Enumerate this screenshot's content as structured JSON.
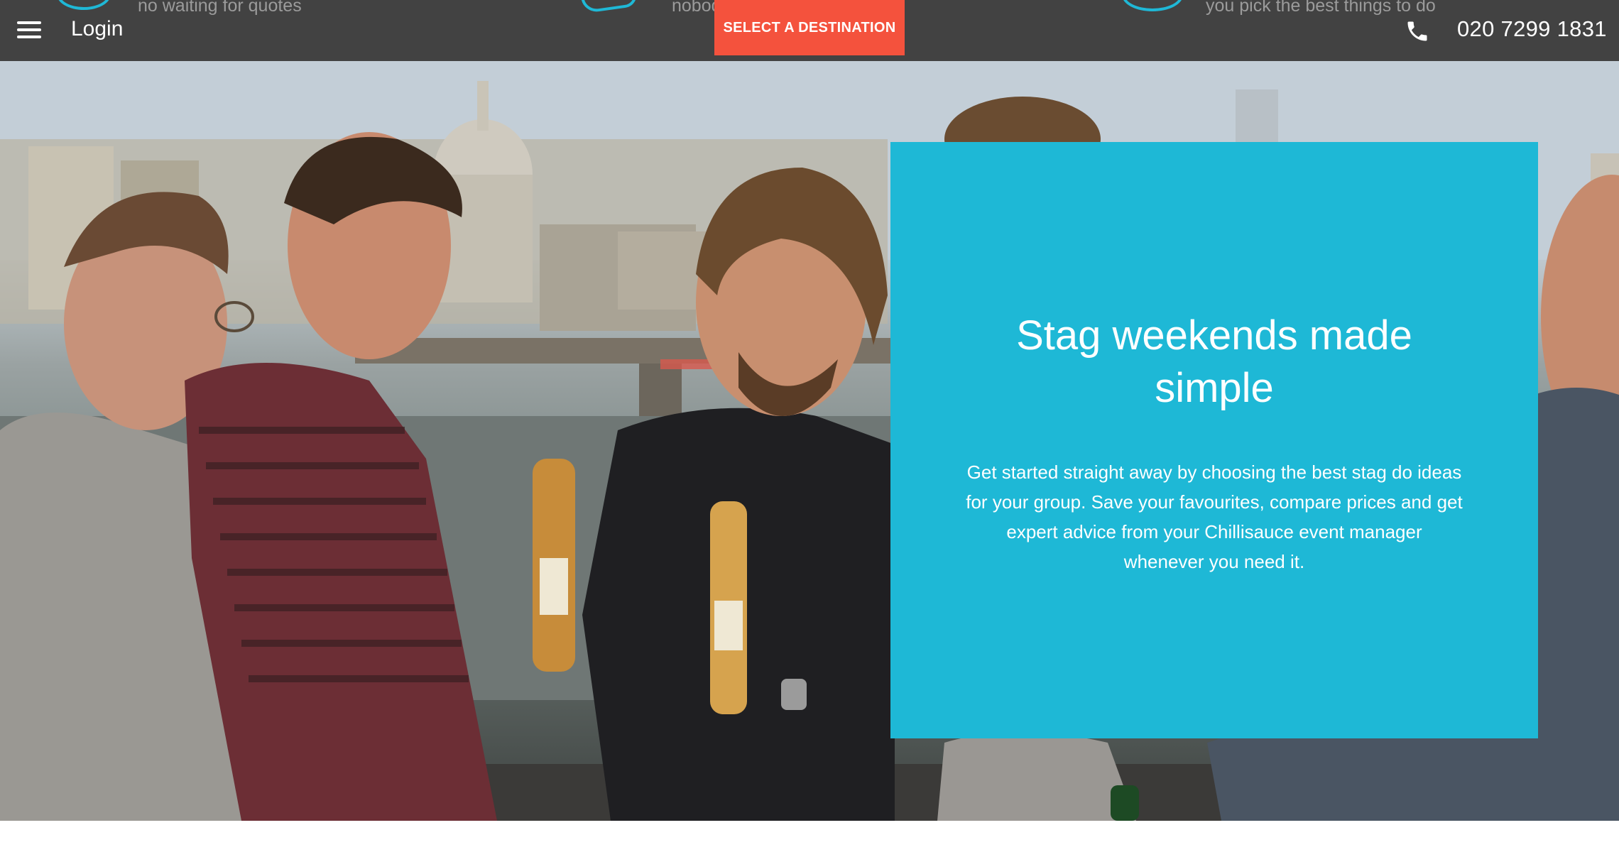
{
  "header": {
    "login_label": "Login",
    "cta_label": "SELECT A DESTINATION",
    "phone_number": "020 7299 1831",
    "peek_texts": [
      "no waiting for quotes",
      "nobody will be out of pocket",
      "you pick the best things to do"
    ]
  },
  "hero": {
    "title": "Stag weekends made simple",
    "body": "Get started straight away by choosing the best stag do ideas for your group. Save your favourites, compare prices and get expert advice from your Chillisauce event manager whenever you need it."
  },
  "colors": {
    "topbar": "#424242",
    "accent_cta": "#f4523d",
    "panel": "#1eb8d6",
    "text_light": "#ffffff"
  },
  "icons": [
    "menu-icon",
    "phone-icon"
  ]
}
